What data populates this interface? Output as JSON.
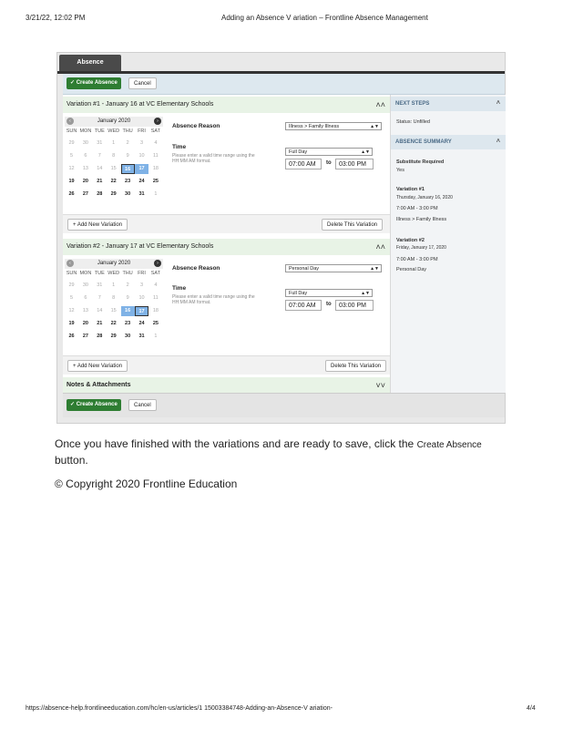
{
  "print_header": {
    "datetime": "3/21/22, 12:02 PM",
    "title": "Adding an Absence V  ariation – Frontline Absence Management"
  },
  "print_footer": {
    "url": "https://absence-help.frontlineeducation.com/hc/en-us/articles/1     15003384748-Adding-an-Absence-V   ariation-",
    "page": "4/4"
  },
  "screenshot": {
    "tab_label": "Absence",
    "create_label": "✓ Create Absence",
    "cancel_label": "Cancel",
    "variations": [
      {
        "header": "Variation #1 - January 16  at  VC Elementary Schools",
        "calendar": {
          "month": "January 2020",
          "dows": [
            "SUN",
            "MON",
            "TUE",
            "WED",
            "THU",
            "FRI",
            "SAT"
          ],
          "weeks": [
            [
              "29",
              "30",
              "31",
              "1",
              "2",
              "3",
              "4"
            ],
            [
              "5",
              "6",
              "7",
              "8",
              "9",
              "10",
              "11"
            ],
            [
              "12",
              "13",
              "14",
              "15",
              "16",
              "17",
              "18"
            ],
            [
              "19",
              "20",
              "21",
              "22",
              "23",
              "24",
              "25"
            ],
            [
              "26",
              "27",
              "28",
              "29",
              "30",
              "31",
              "1"
            ]
          ],
          "selected_day": "16",
          "highlight_day": "17"
        },
        "reason_label": "Absence Reason",
        "reason_value": "Illness > Family Illness",
        "time_label": "Time",
        "time_hint": "Please enter a valid time range using the HH:MM AM format.",
        "duration": "Full Day",
        "start": "07:00 AM",
        "to": "to",
        "end": "03:00 PM",
        "add_label": "+ Add New Variation",
        "delete_label": "Delete This Variation"
      },
      {
        "header": "Variation #2 - January 17  at  VC Elementary Schools",
        "calendar": {
          "month": "January 2020",
          "dows": [
            "SUN",
            "MON",
            "TUE",
            "WED",
            "THU",
            "FRI",
            "SAT"
          ],
          "weeks": [
            [
              "29",
              "30",
              "31",
              "1",
              "2",
              "3",
              "4"
            ],
            [
              "5",
              "6",
              "7",
              "8",
              "9",
              "10",
              "11"
            ],
            [
              "12",
              "13",
              "14",
              "15",
              "16",
              "17",
              "18"
            ],
            [
              "19",
              "20",
              "21",
              "22",
              "23",
              "24",
              "25"
            ],
            [
              "26",
              "27",
              "28",
              "29",
              "30",
              "31",
              "1"
            ]
          ],
          "selected_day": "17",
          "highlight_day": "16"
        },
        "reason_label": "Absence Reason",
        "reason_value": "Personal Day",
        "time_label": "Time",
        "time_hint": "Please enter a valid time range using the HH:MM AM format.",
        "duration": "Full Day",
        "start": "07:00 AM",
        "to": "to",
        "end": "03:00 PM",
        "add_label": "+ Add New Variation",
        "delete_label": "Delete This Variation"
      }
    ],
    "notes_label": "Notes & Attachments",
    "side": {
      "next_steps": "NEXT STEPS",
      "status": "Status: Unfilled",
      "summary": "ABSENCE SUMMARY",
      "sub_req_label": "Substitute Required",
      "sub_req_value": "Yes",
      "v1_title": "Variation #1",
      "v1_date": "Thursday, January 16, 2020",
      "v1_time": "7:00 AM - 3:00 PM",
      "v1_reason": "Illness > Family Illness",
      "v2_title": "Variation #2",
      "v2_date": "Friday, January 17, 2020",
      "v2_time": "7:00 AM - 3:00 PM",
      "v2_reason": "Personal Day"
    }
  },
  "body": {
    "instruction_pre": "Once you have finished with the variations and are ready to save, click the ",
    "instruction_button": "Create Absence",
    "instruction_post": "button.",
    "copyright": "© Copyright 2020 Frontline Education"
  },
  "colors": {
    "create_green": "#2e7d32",
    "variation_header": "#e8f3e6",
    "side_header": "#dde7ee",
    "selected_day": "#7fb2e6"
  }
}
